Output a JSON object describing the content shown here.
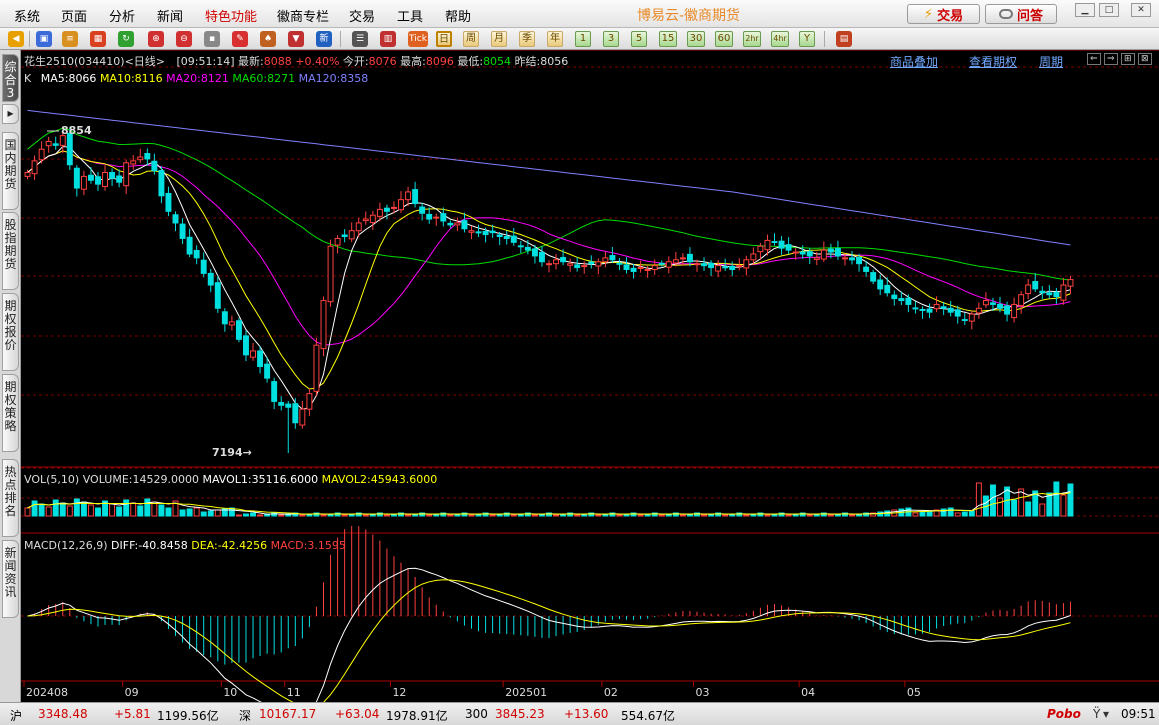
{
  "menu": {
    "items": [
      "系统",
      "页面",
      "分析",
      "新闻",
      "特色功能",
      "徽商专栏",
      "交易",
      "工具",
      "帮助"
    ],
    "highlight": "特色功能"
  },
  "app_title": "博易云-徽商期货",
  "top_buttons": {
    "trade": "交易",
    "qa": "问答"
  },
  "toolbar": {
    "periods": [
      "日",
      "周",
      "月",
      "季",
      "年",
      "1",
      "3",
      "5",
      "15",
      "30",
      "60",
      "2hr",
      "4hr",
      "Y"
    ],
    "misc_labels": {
      "tick": "Tick",
      "new": "新"
    }
  },
  "sidebar": {
    "tabs": [
      "综合3",
      "国内期货",
      "股指期货",
      "期权报价",
      "期权策略",
      "热点排名",
      "新闻资讯"
    ]
  },
  "quote": {
    "name": "花生2510",
    "code": "(034410)",
    "period": "<日线>",
    "time": "[09:51:14]",
    "last_label": "最新:",
    "last": "8088",
    "change": "+0.40%",
    "open_label": "今开:",
    "open": "8076",
    "high_label": "最高:",
    "high": "8096",
    "low_label": "最低:",
    "low": "8054",
    "prev_label": "昨结:",
    "prev": "8056"
  },
  "links": {
    "overlay": "商品叠加",
    "options": "查看期权",
    "cycle": "周期"
  },
  "ma_legend": {
    "k": "K",
    "ma5": "MA5:8066",
    "ma10": "MA10:8116",
    "ma20": "MA20:8121",
    "ma60": "MA60:8271",
    "ma120": "MA120:8358"
  },
  "vol_legend": {
    "name": "VOL(5,10)",
    "volume": "VOLUME:14529.0000",
    "mavol1": "MAVOL1:35116.6000",
    "mavol2": "MAVOL2:45943.6000"
  },
  "macd_legend": {
    "name": "MACD(12,26,9)",
    "diff": "DIFF:-40.8458",
    "dea": "DEA:-42.4256",
    "macd": "MACD:3.1595"
  },
  "colors": {
    "up": "#ff4040",
    "down": "#00e0e0",
    "ma5": "#ffffff",
    "ma10": "#ffff00",
    "ma20": "#ff00ff",
    "ma60": "#00dd00",
    "ma120": "#8080ff",
    "grid": "#7a0000"
  },
  "chart_data": {
    "type": "candlestick",
    "symbol": "花生2510",
    "high_label": "8854",
    "low_label": "7194",
    "x_ticks": [
      "202408",
      "09",
      "10",
      "11",
      "12",
      "202501",
      "02",
      "03",
      "04",
      "05"
    ],
    "closes": [
      8640,
      8700,
      8760,
      8800,
      8780,
      8830,
      8680,
      8560,
      8620,
      8600,
      8580,
      8640,
      8610,
      8590,
      8690,
      8700,
      8720,
      8710,
      8650,
      8520,
      8440,
      8380,
      8300,
      8220,
      8200,
      8120,
      8060,
      7940,
      7860,
      7870,
      7780,
      7700,
      7720,
      7640,
      7580,
      7460,
      7440,
      7430,
      7350,
      7420,
      7500,
      7750,
      7980,
      8260,
      8300,
      8310,
      8340,
      8380,
      8400,
      8420,
      8450,
      8440,
      8460,
      8500,
      8540,
      8480,
      8430,
      8400,
      8410,
      8390,
      8370,
      8380,
      8350,
      8340,
      8330,
      8320,
      8330,
      8310,
      8300,
      8280,
      8260,
      8240,
      8210,
      8180,
      8170,
      8190,
      8180,
      8170,
      8150,
      8160,
      8170,
      8180,
      8200,
      8190,
      8170,
      8140,
      8130,
      8150,
      8140,
      8160,
      8170,
      8180,
      8190,
      8200,
      8180,
      8170,
      8160,
      8150,
      8160,
      8150,
      8140,
      8160,
      8190,
      8220,
      8260,
      8290,
      8280,
      8250,
      8240,
      8230,
      8220,
      8210,
      8200,
      8240,
      8230,
      8210,
      8200,
      8190,
      8170,
      8130,
      8080,
      8040,
      8020,
      7990,
      7980,
      7960,
      7940,
      7930,
      7920,
      7960,
      7940,
      7920,
      7900,
      7880,
      7910,
      7940,
      7980,
      7960,
      7940,
      7910,
      7960,
      8010,
      8060,
      8040,
      8020,
      8010,
      8000,
      8060,
      8088
    ],
    "ohlc_note": "Values estimated from chart; candles bodies approximated around closes"
  },
  "status": {
    "sh_label": "沪",
    "sh_index": "3348.48",
    "sh_change": "+5.81",
    "sh_amount": "1199.56亿",
    "sz_label": "深",
    "sz_index": "10167.17",
    "sz_change": "+63.04",
    "sz_amount": "1978.91亿",
    "i300_label": "300",
    "i300": "3845.23",
    "i300_change": "+13.60",
    "i300_amount": "554.67亿",
    "brand": "Pobo",
    "clock": "09:51"
  }
}
